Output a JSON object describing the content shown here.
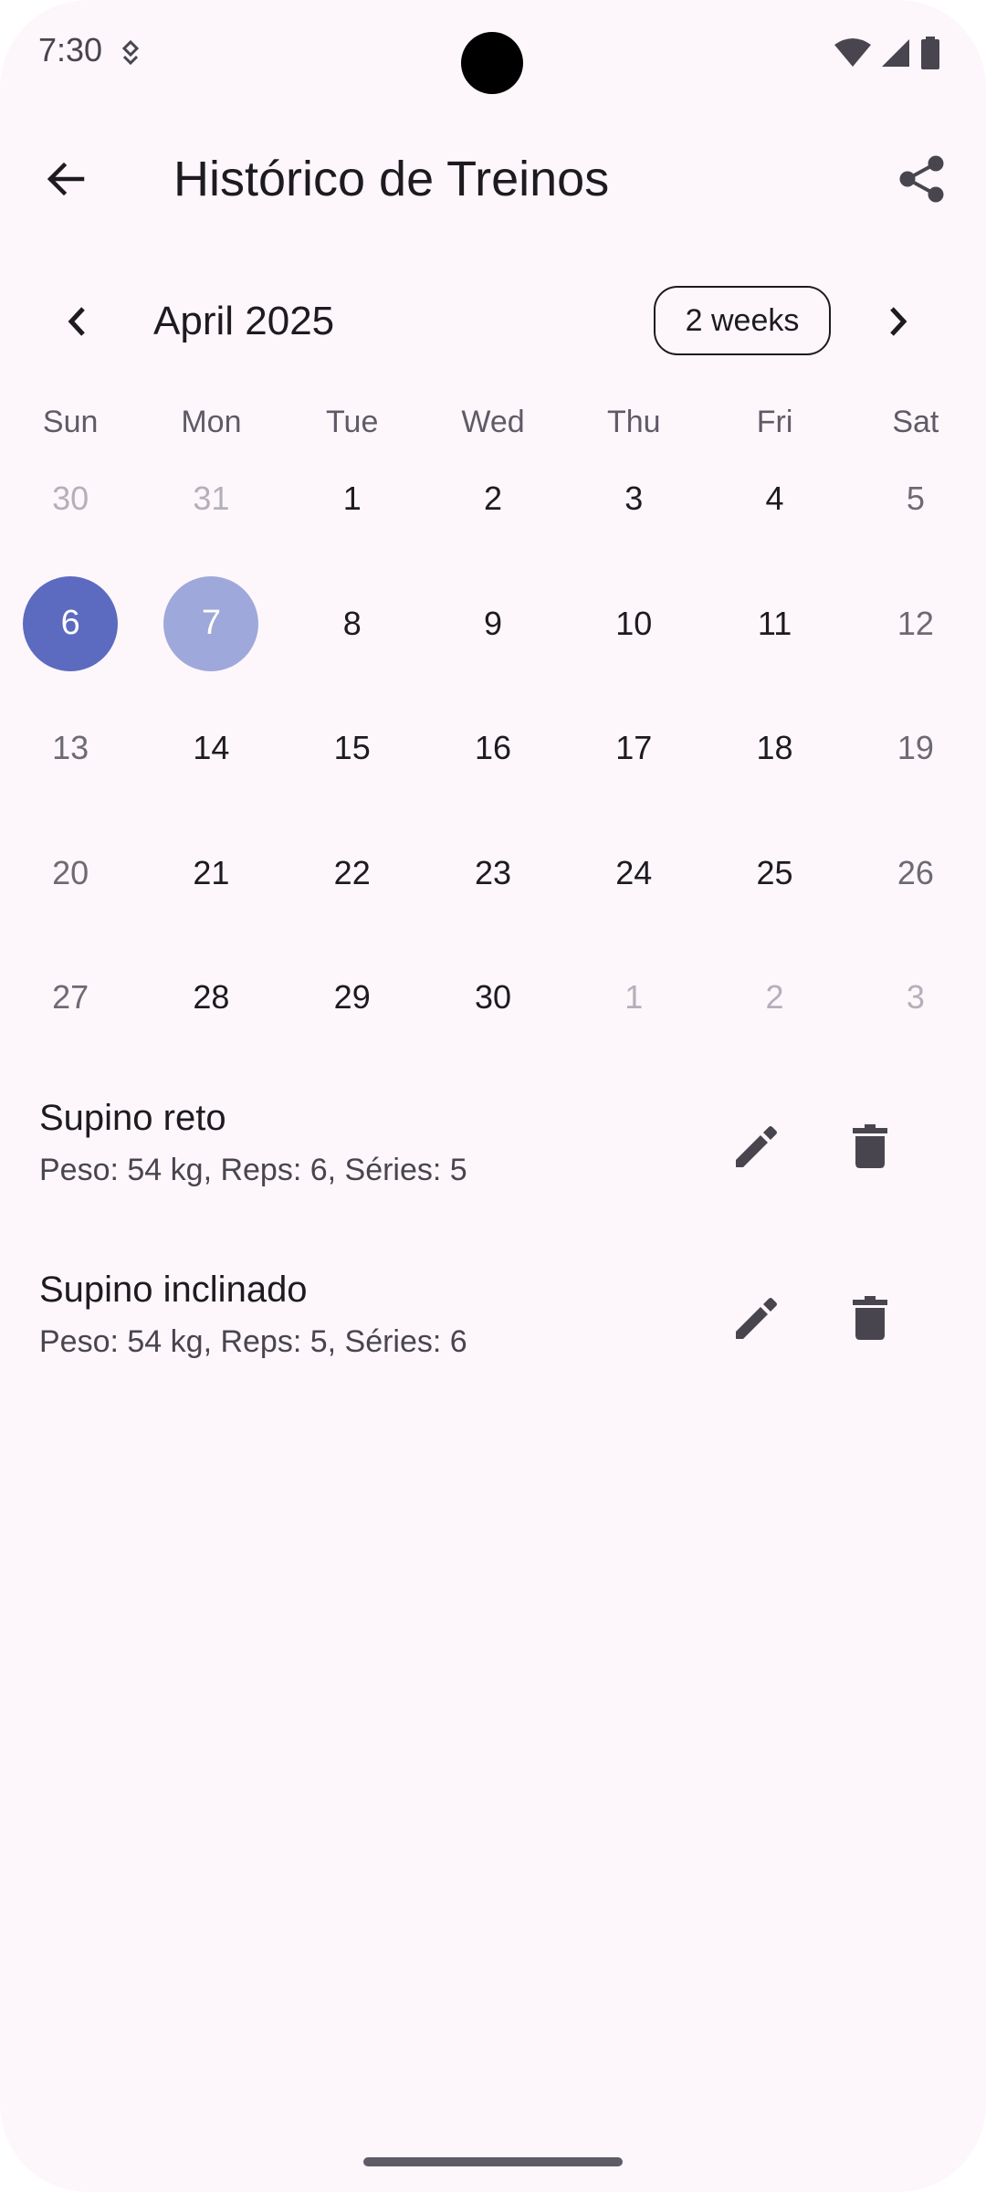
{
  "status_bar": {
    "time": "7:30"
  },
  "app_bar": {
    "title": "Histórico de Treinos",
    "back_icon": "arrow-back-icon",
    "share_icon": "share-icon"
  },
  "calendar": {
    "month_label": "April 2025",
    "format_button": "2 weeks",
    "days_of_week": [
      "Sun",
      "Mon",
      "Tue",
      "Wed",
      "Thu",
      "Fri",
      "Sat"
    ],
    "weeks": [
      [
        "30",
        "31",
        "1",
        "2",
        "3",
        "4",
        "5"
      ],
      [
        "6",
        "7",
        "8",
        "9",
        "10",
        "11",
        "12"
      ],
      [
        "13",
        "14",
        "15",
        "16",
        "17",
        "18",
        "19"
      ],
      [
        "20",
        "21",
        "22",
        "23",
        "24",
        "25",
        "26"
      ],
      [
        "27",
        "28",
        "29",
        "30",
        "1",
        "2",
        "3"
      ]
    ],
    "selected_day": "6",
    "today_day": "7",
    "colors": {
      "selected": "#5c6bc0",
      "today": "#9fa8da"
    }
  },
  "workouts": [
    {
      "name": "Supino reto",
      "details": "Peso: 54 kg, Reps: 6, Séries: 5"
    },
    {
      "name": "Supino inclinado",
      "details": "Peso: 54 kg, Reps: 5, Séries: 6"
    }
  ],
  "colors": {
    "background": "#fdf7fc",
    "text_primary": "#1d1b20",
    "text_secondary": "#49454f"
  }
}
